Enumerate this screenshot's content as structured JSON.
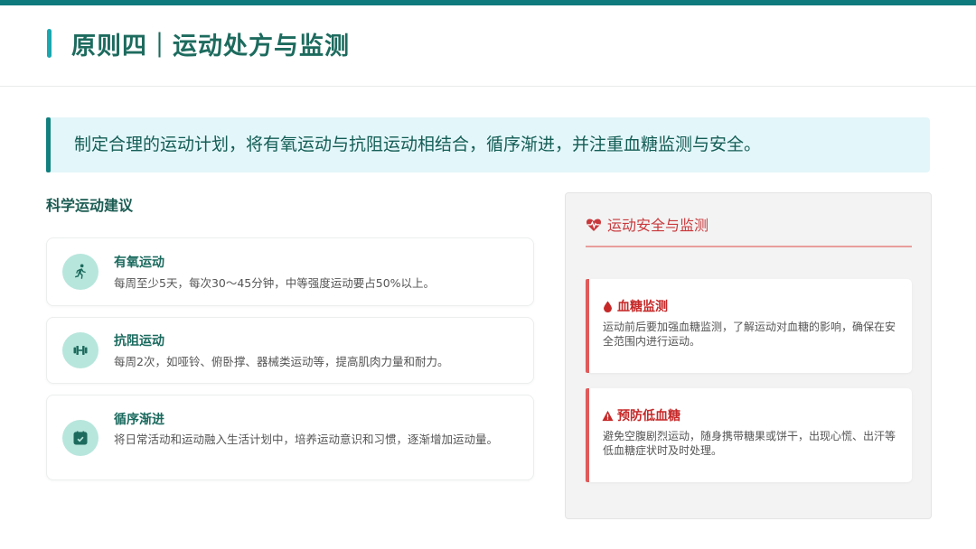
{
  "header": {
    "title": "原则四｜运动处方与监测"
  },
  "banner": {
    "text": "制定合理的运动计划，将有氧运动与抗阻运动相结合，循序渐进，并注重血糖监测与安全。"
  },
  "recommendations": {
    "heading": "科学运动建议",
    "items": [
      {
        "icon": "running-person-icon",
        "title": "有氧运动",
        "desc": "每周至少5天，每次30～45分钟，中等强度运动要占50%以上。"
      },
      {
        "icon": "dumbbell-icon",
        "title": "抗阻运动",
        "desc": "每周2次，如哑铃、俯卧撑、器械类运动等，提高肌肉力量和耐力。"
      },
      {
        "icon": "calendar-check-icon",
        "title": "循序渐进",
        "desc": "将日常活动和运动融入生活计划中，培养运动意识和习惯，逐渐增加运动量。"
      }
    ]
  },
  "safety": {
    "title": "运动安全与监测",
    "title_icon": "heartbeat-icon",
    "items": [
      {
        "icon": "blood-drop-icon",
        "title": "血糖监测",
        "desc": "运动前后要加强血糖监测，了解运动对血糖的影响，确保在安全范围内进行运动。"
      },
      {
        "icon": "warning-triangle-icon",
        "title": "预防低血糖",
        "desc": "避免空腹剧烈运动，随身携带糖果或饼干，出现心慌、出汗等低血糖症状时及时处理。"
      }
    ]
  },
  "colors": {
    "primary": "#0e7a7e",
    "accent": "#1aa7b0",
    "icon_bg": "#b7e6dc",
    "danger": "#c62828"
  }
}
